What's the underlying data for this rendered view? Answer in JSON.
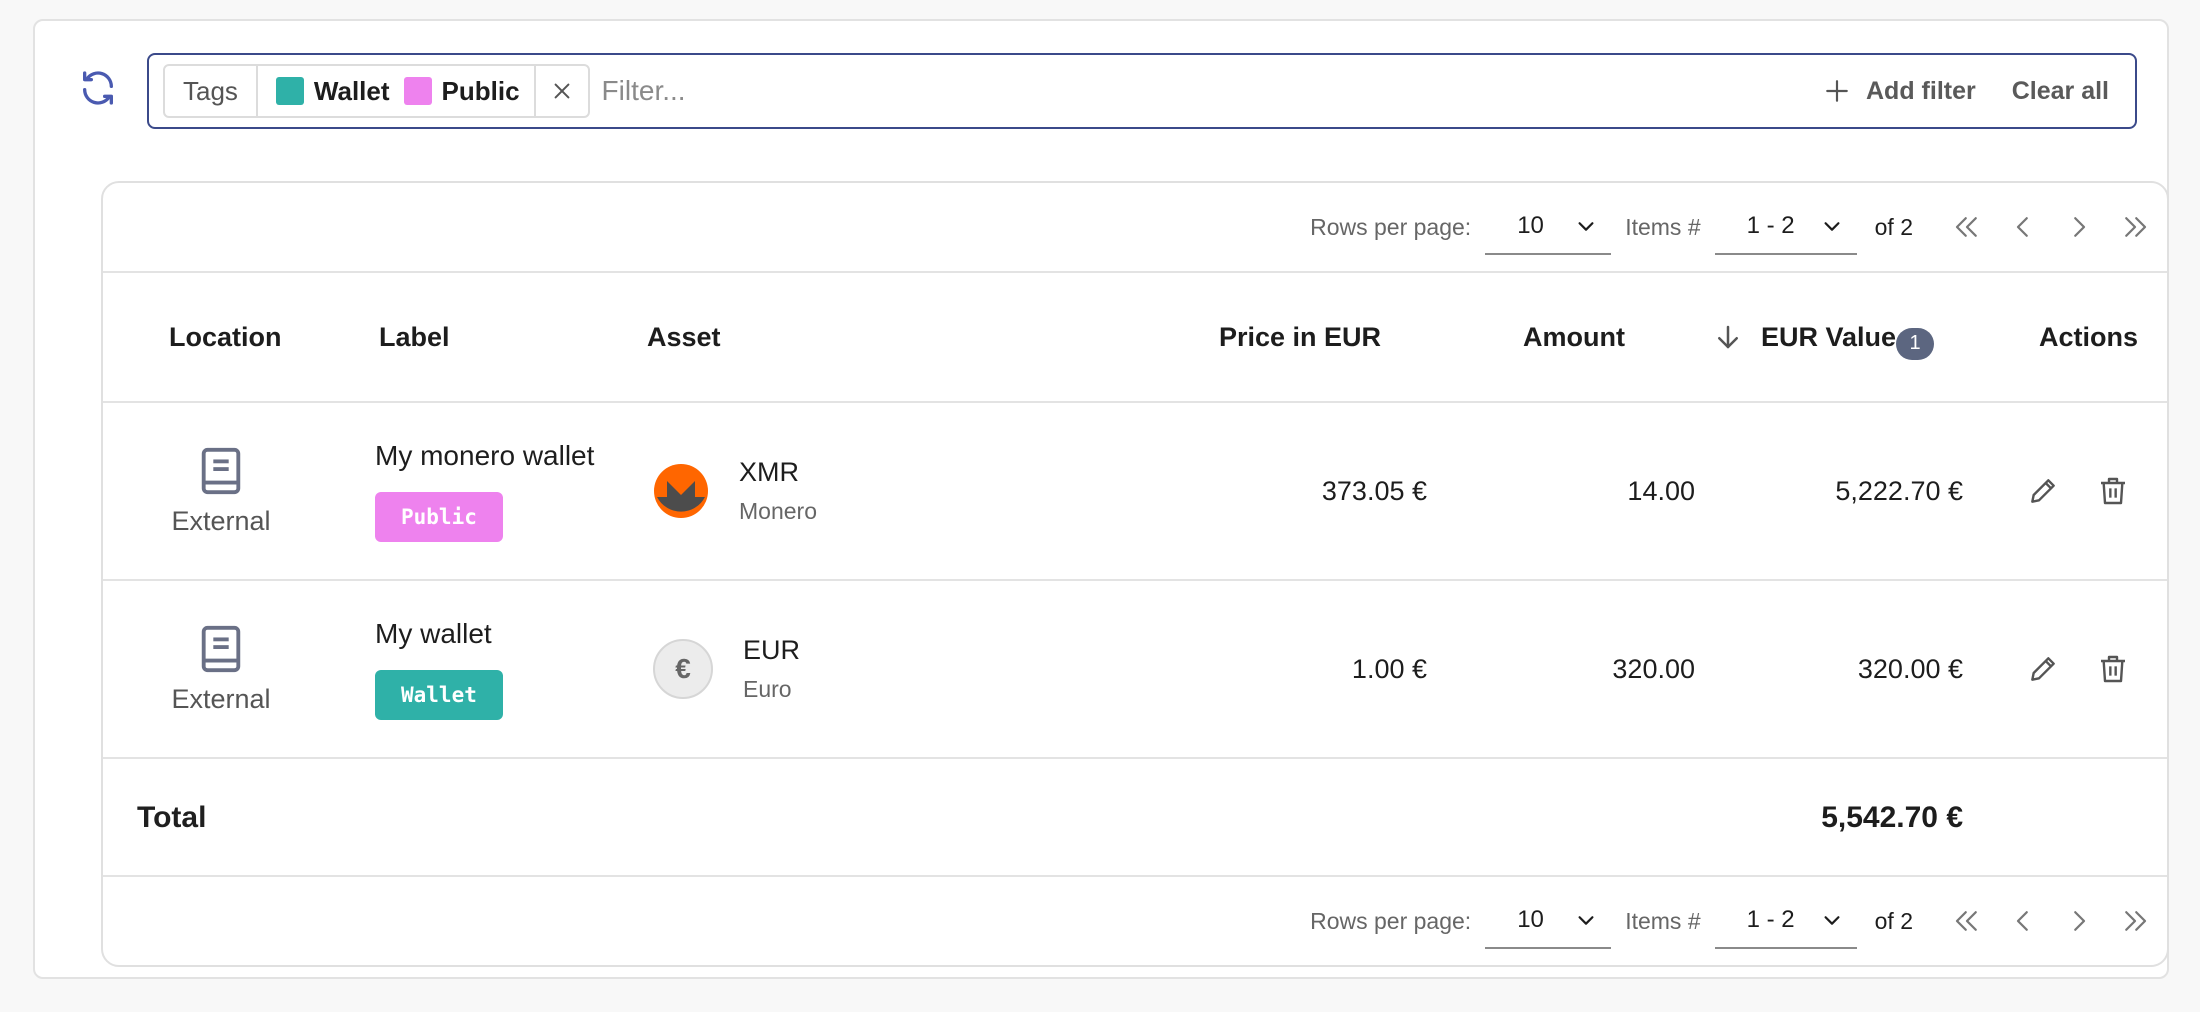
{
  "filter": {
    "chip_key": "Tags",
    "chip_values": [
      {
        "label": "Wallet",
        "color": "#2fb1a8"
      },
      {
        "label": "Public",
        "color": "#ee82ee"
      }
    ],
    "placeholder": "Filter...",
    "add_filter_label": "Add filter",
    "clear_all_label": "Clear all"
  },
  "pagination": {
    "rows_per_page_label": "Rows per page:",
    "rows_per_page_value": "10",
    "items_label": "Items #",
    "items_range": "1 - 2",
    "of_total": "of 2"
  },
  "columns": {
    "location": "Location",
    "label": "Label",
    "asset": "Asset",
    "price": "Price in EUR",
    "amount": "Amount",
    "value": "EUR Value",
    "value_sort_badge": "1",
    "actions": "Actions"
  },
  "rows": [
    {
      "location": "External",
      "label": "My monero wallet",
      "tag": "Public",
      "tag_color": "#ee82ee",
      "asset_symbol": "XMR",
      "asset_name": "Monero",
      "asset_icon": "monero-icon",
      "price": "373.05 €",
      "amount": "14.00",
      "value": "5,222.70 €"
    },
    {
      "location": "External",
      "label": "My wallet",
      "tag": "Wallet",
      "tag_color": "#2fb1a8",
      "asset_symbol": "EUR",
      "asset_name": "Euro",
      "asset_icon_glyph": "€",
      "price": "1.00 €",
      "amount": "320.00",
      "value": "320.00 €"
    }
  ],
  "total": {
    "label": "Total",
    "value": "5,542.70 €"
  }
}
